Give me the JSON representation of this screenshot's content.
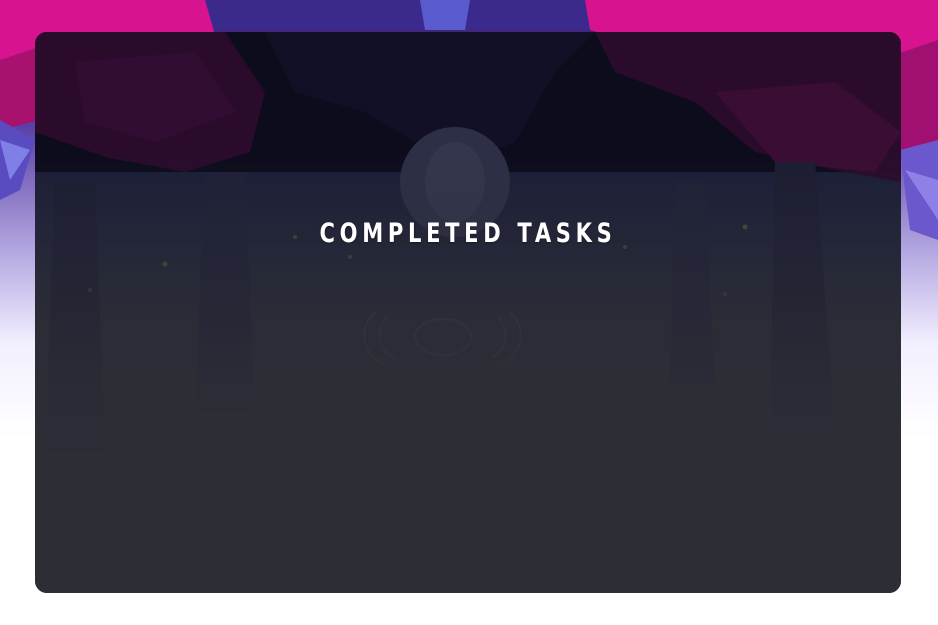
{
  "panel": {
    "title": "COMPLETED TASKS"
  },
  "colors": {
    "magenta": "#d4168f",
    "purple": "#5a3fa6",
    "panel_dark": "#2d2e35",
    "title_text": "#ffffff"
  },
  "icons": {
    "emblem": "faint-crest-emblem-icon"
  }
}
